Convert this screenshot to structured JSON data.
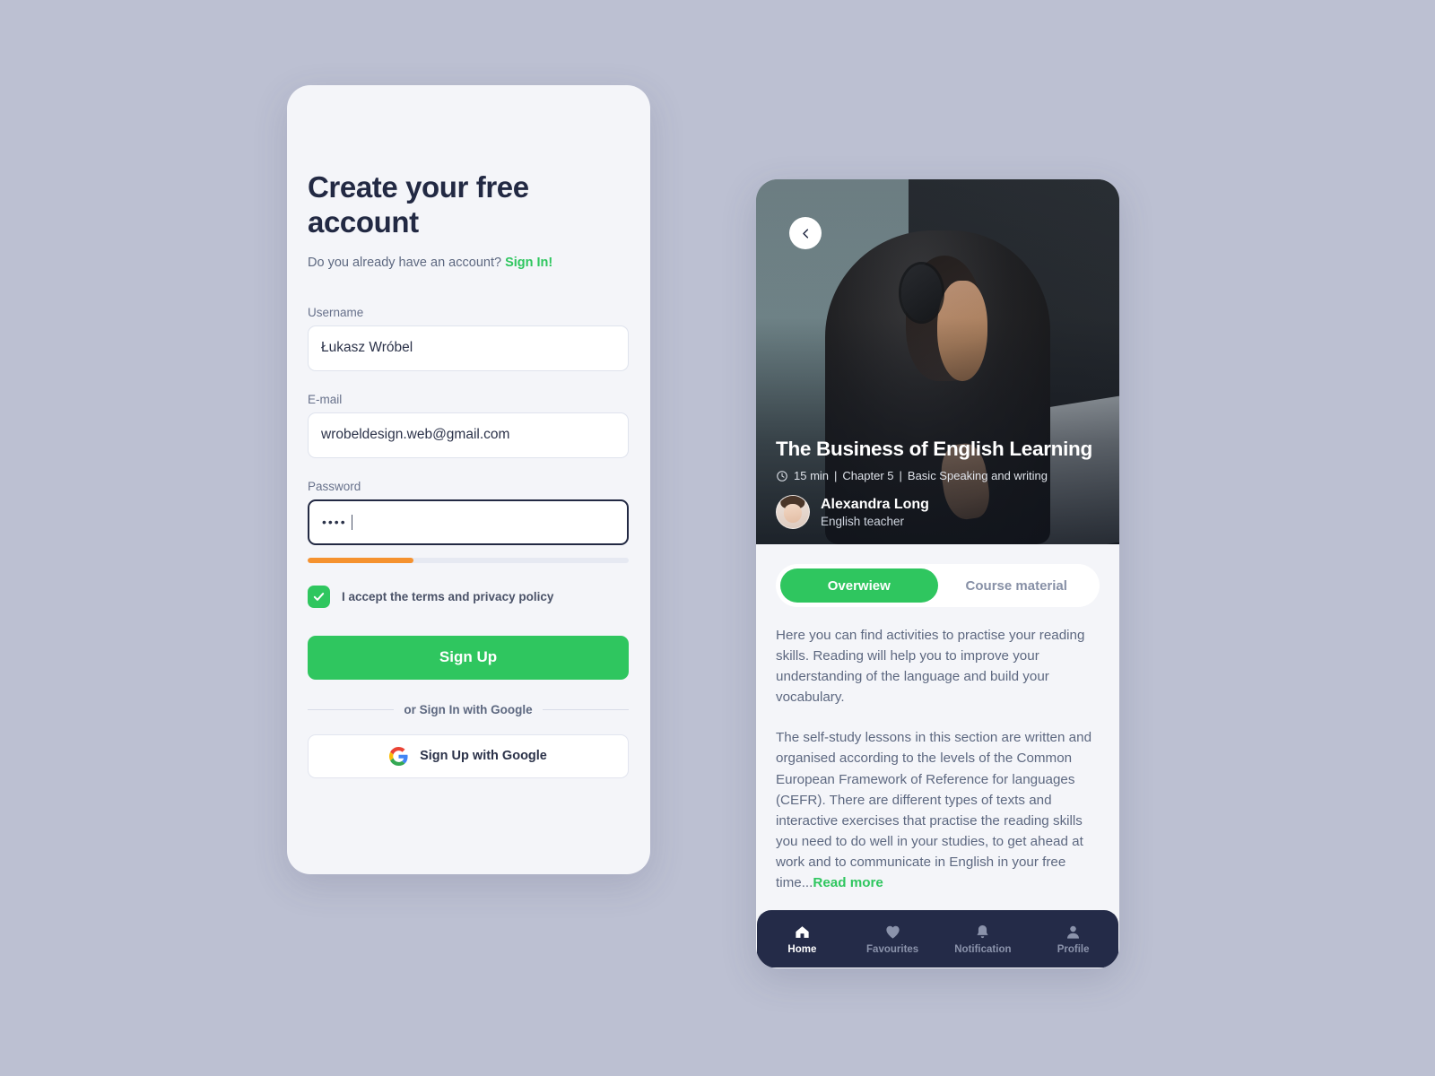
{
  "theme": {
    "background": "#bcc0d2",
    "accent_green": "#2fc65f",
    "dark_navy": "#242b48",
    "strength_orange": "#f5922f",
    "card_bg": "#f4f5f9"
  },
  "signup": {
    "title": "Create your free account",
    "have_account_text": "Do you already have an account?",
    "signin_link": "Sign In!",
    "fields": [
      {
        "label": "Username",
        "value": "Łukasz Wróbel",
        "focused": false
      },
      {
        "label": "E-mail",
        "value": "wrobeldesign.web@gmail.com",
        "focused": false
      }
    ],
    "password": {
      "label": "Password",
      "value": "••••",
      "focused": true,
      "strength_percent": 33
    },
    "terms_label": "I accept the terms and privacy policy",
    "terms_checked": true,
    "signup_button": "Sign Up",
    "divider_text": "or Sign In with Google",
    "google_button": "Sign Up with Google"
  },
  "course": {
    "back_icon": "chevron-left-icon",
    "title": "The Business of English Learning",
    "duration": "15 min",
    "chapter": "Chapter 5",
    "level": "Basic Speaking and writing",
    "meta_separator": "|",
    "teacher": {
      "name": "Alexandra Long",
      "role": "English teacher"
    },
    "tabs": [
      {
        "label": "Overwiew",
        "active": true
      },
      {
        "label": "Course material",
        "active": false
      }
    ],
    "paragraphs": [
      "Here you can find activities to practise your reading skills. Reading will help you to improve your understanding of the language and build your vocabulary.",
      "The self-study lessons in this section are written and organised according to the levels of the Common European Framework of Reference for languages (CEFR). There are different types of texts and interactive exercises that practise the reading skills you need to do well in your studies, to get ahead at work and to communicate in English in your free time..."
    ],
    "read_more": "Read more",
    "nav": [
      {
        "label": "Home",
        "icon": "home-icon",
        "active": true
      },
      {
        "label": "Favourites",
        "icon": "heart-icon",
        "active": false
      },
      {
        "label": "Notification",
        "icon": "bell-icon",
        "active": false
      },
      {
        "label": "Profile",
        "icon": "person-icon",
        "active": false
      }
    ]
  }
}
